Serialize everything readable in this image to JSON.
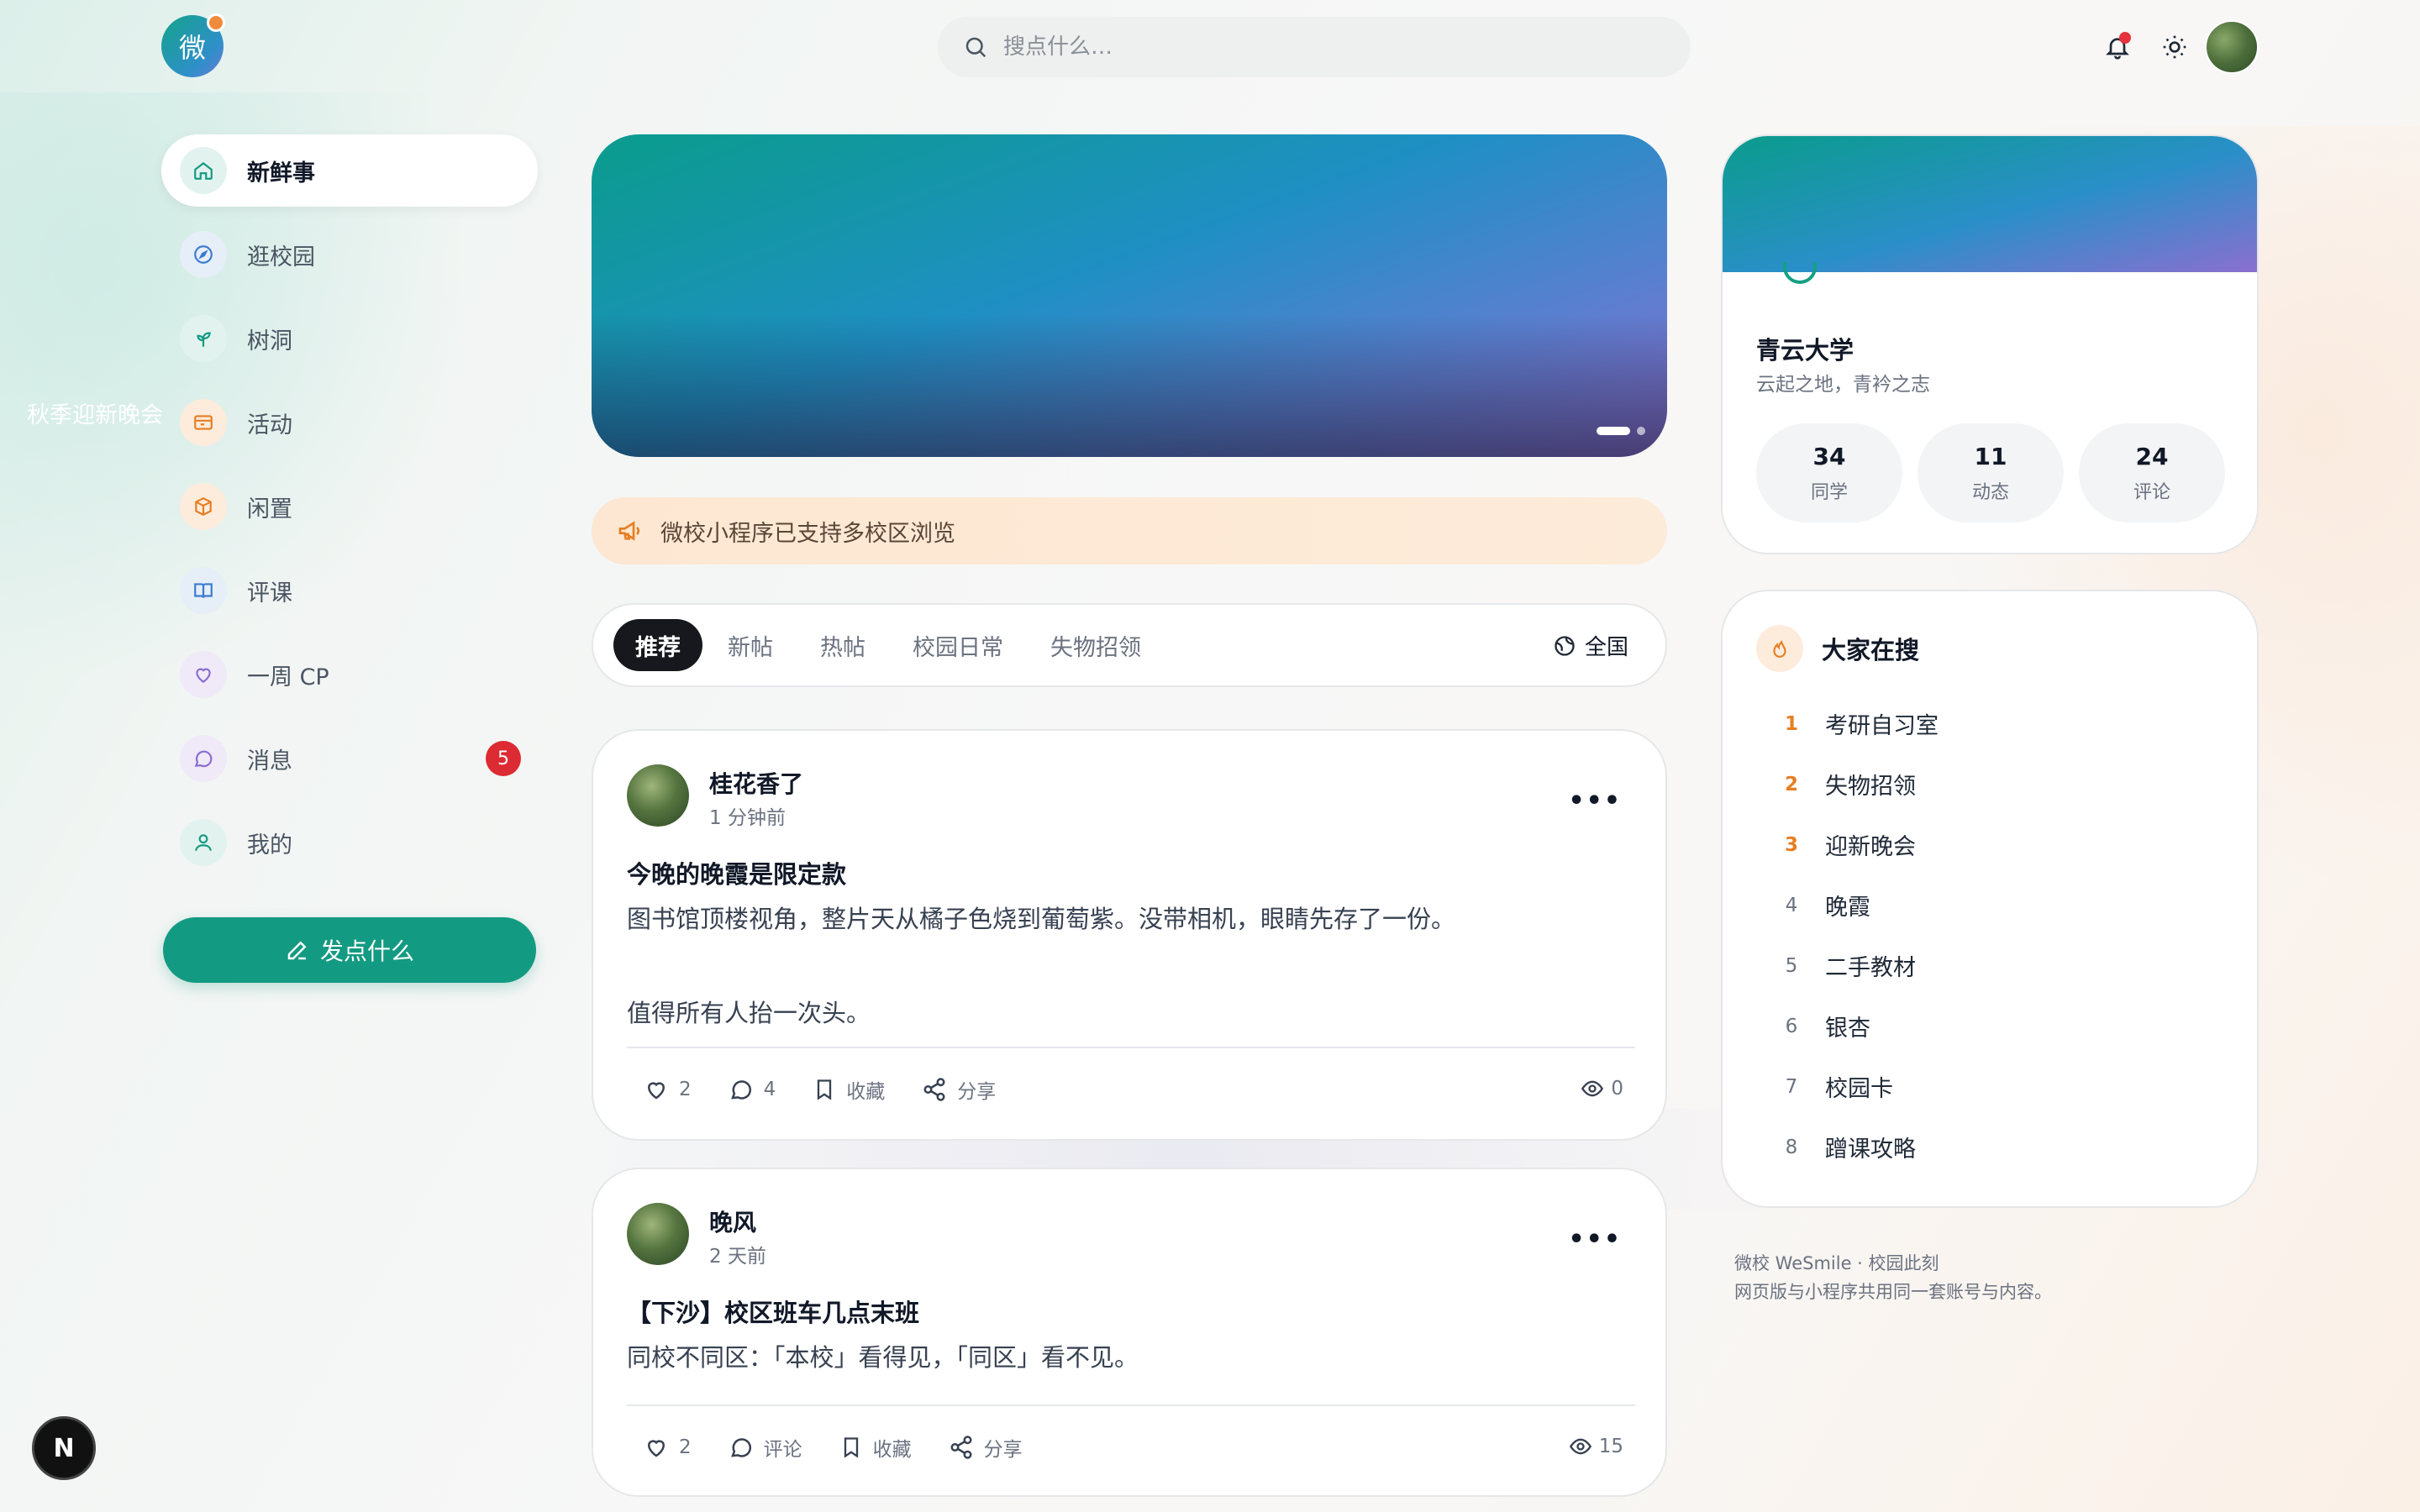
{
  "header": {
    "logo_text": "微",
    "search_placeholder": "搜点什么…"
  },
  "sidebar": {
    "items": [
      {
        "label": "新鲜事",
        "icon": "home-icon",
        "active": true
      },
      {
        "label": "逛校园",
        "icon": "compass-icon"
      },
      {
        "label": "树洞",
        "icon": "sprout-icon"
      },
      {
        "label": "活动",
        "icon": "ticket-icon"
      },
      {
        "label": "闲置",
        "icon": "package-icon"
      },
      {
        "label": "评课",
        "icon": "book-icon"
      },
      {
        "label": "一周 CP",
        "icon": "heart-icon"
      },
      {
        "label": "消息",
        "icon": "chat-icon",
        "badge": "5"
      },
      {
        "label": "我的",
        "icon": "user-icon"
      }
    ],
    "post_button": "发点什么"
  },
  "banner": {
    "title": "秋季迎新晚会"
  },
  "notice": {
    "text": "微校小程序已支持多校区浏览"
  },
  "tabs": {
    "items": [
      "推荐",
      "新帖",
      "热帖",
      "校园日常",
      "失物招领"
    ],
    "active": "推荐",
    "region": "全国"
  },
  "posts": [
    {
      "author": "桂花香了",
      "time": "1 分钟前",
      "title": "今晚的晚霞是限定款",
      "body": [
        "图书馆顶楼视角，整片天从橘子色烧到葡萄紫。没带相机，眼睛先存了一份。",
        "",
        "值得所有人抬一次头。"
      ],
      "likes": "2",
      "comments": "4",
      "save_label": "收藏",
      "share_label": "分享",
      "views": "0"
    },
    {
      "author": "晚风",
      "time": "2 天前",
      "title": "【下沙】校区班车几点末班",
      "body": [
        "同校不同区：「本校」看得见，「同区」看不见。"
      ],
      "likes": "2",
      "comments": "评论",
      "save_label": "收藏",
      "share_label": "分享",
      "views": "15"
    }
  ],
  "school": {
    "name": "青云大学",
    "motto": "云起之地，青衿之志",
    "stats": [
      {
        "value": "34",
        "label": "同学"
      },
      {
        "value": "11",
        "label": "动态"
      },
      {
        "value": "24",
        "label": "评论"
      }
    ]
  },
  "trending": {
    "title": "大家在搜",
    "items": [
      {
        "rank": "1",
        "text": "考研自习室"
      },
      {
        "rank": "2",
        "text": "失物招领"
      },
      {
        "rank": "3",
        "text": "迎新晚会"
      },
      {
        "rank": "4",
        "text": "晚霞"
      },
      {
        "rank": "5",
        "text": "二手教材"
      },
      {
        "rank": "6",
        "text": "银杏"
      },
      {
        "rank": "7",
        "text": "校园卡"
      },
      {
        "rank": "8",
        "text": "蹭课攻略"
      }
    ]
  },
  "footer": {
    "line1": "微校 WeSmile · 校园此刻",
    "line2": "网页版与小程序共用同一套账号与内容。"
  },
  "dev_badge": "N",
  "colors": {
    "brand": "#139a82",
    "notice_bg": "#fde7d2",
    "badge": "#dc2b33",
    "hot_rank": "#e67e22"
  }
}
